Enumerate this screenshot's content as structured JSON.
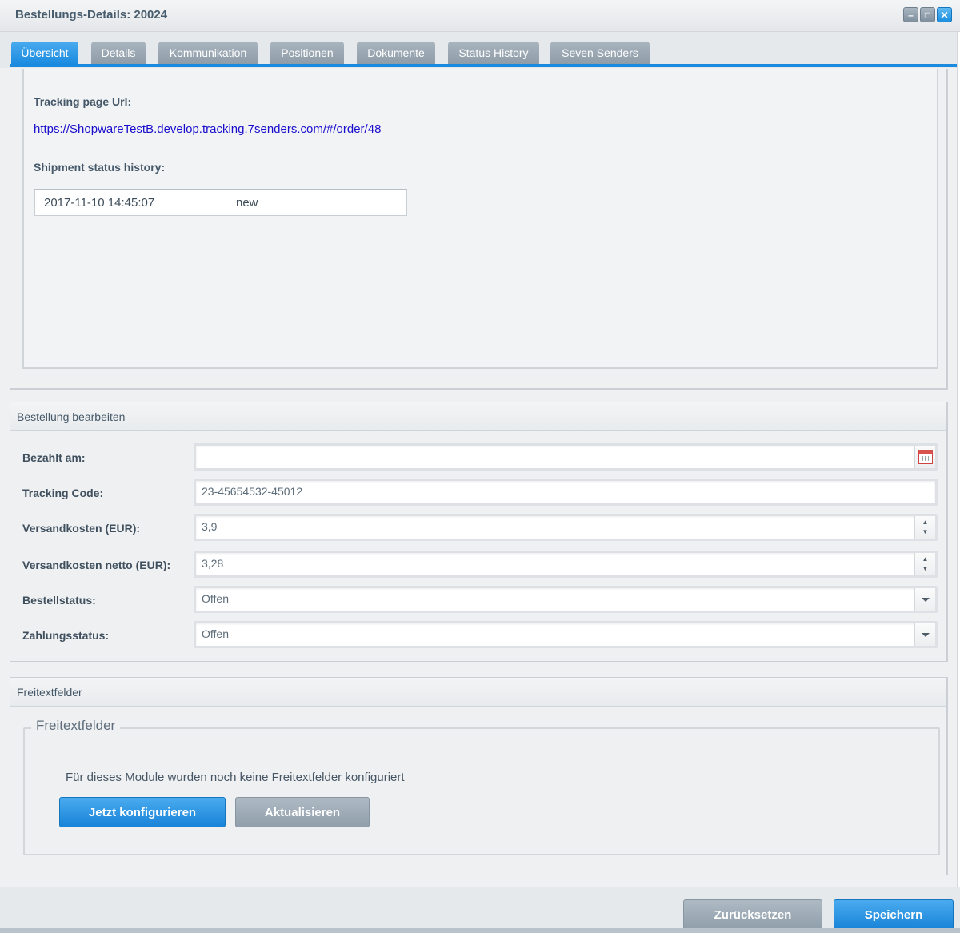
{
  "window": {
    "title": "Bestellungs-Details: 20024",
    "controls": [
      "minimize-icon",
      "maximize-icon",
      "close-icon"
    ]
  },
  "tabs": [
    {
      "label": "Übersicht",
      "active": true
    },
    {
      "label": "Details",
      "active": false
    },
    {
      "label": "Kommunikation",
      "active": false
    },
    {
      "label": "Positionen",
      "active": false
    },
    {
      "label": "Dokumente",
      "active": false
    },
    {
      "label": "Status History",
      "active": false
    },
    {
      "label": "Seven Senders",
      "active": false
    }
  ],
  "shipment": {
    "tracking_url_label": "Tracking page Url:",
    "tracking_url": "https://ShopwareTestB.develop.tracking.7senders.com/#/order/48",
    "history_label": "Shipment status history:",
    "history": [
      {
        "date": "2017-11-10 14:45:07",
        "status": "new"
      }
    ]
  },
  "edit_order": {
    "header": "Bestellung bearbeiten",
    "fields": {
      "paid_at": {
        "label": "Bezahlt am:",
        "value": ""
      },
      "tracking_code": {
        "label": "Tracking Code:",
        "value": "23-45654532-45012"
      },
      "shipping_cost": {
        "label": "Versandkosten (EUR):",
        "value": "3,9"
      },
      "shipping_cost_net": {
        "label": "Versandkosten netto (EUR):",
        "value": "3,28"
      },
      "order_status": {
        "label": "Bestellstatus:",
        "value": "Offen"
      },
      "payment_status": {
        "label": "Zahlungsstatus:",
        "value": "Offen"
      }
    }
  },
  "free_text": {
    "header": "Freitextfelder",
    "legend": "Freitextfelder",
    "message": "Für dieses Module wurden noch keine Freitextfelder konfiguriert",
    "configure_label": "Jetzt konfigurieren",
    "refresh_label": "Aktualisieren"
  },
  "footer": {
    "reset_label": "Zurücksetzen",
    "save_label": "Speichern"
  },
  "colors": {
    "accent": "#1a8adf",
    "tab_inactive": "#9aa7b2",
    "link": "#1a0dcc"
  }
}
